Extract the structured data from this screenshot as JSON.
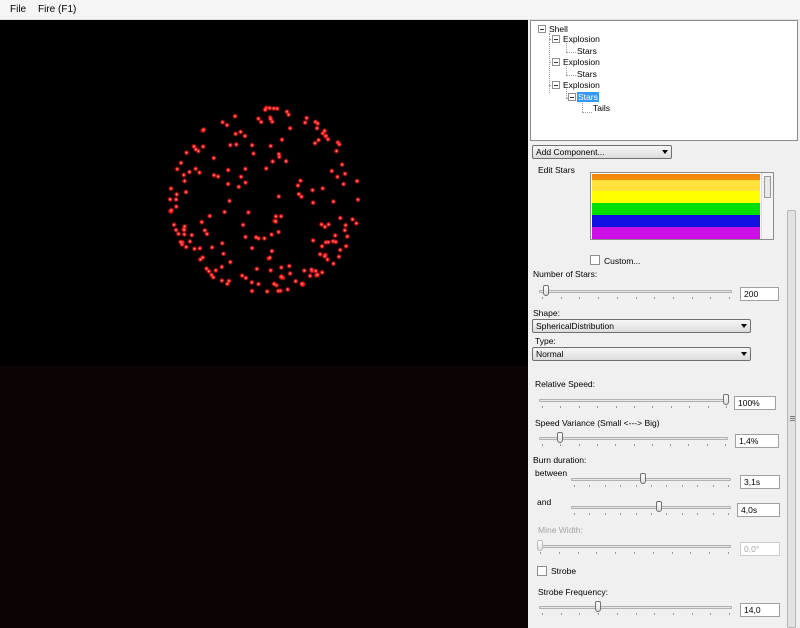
{
  "menu": {
    "file": "File",
    "fire": "Fire (F1)"
  },
  "tree": {
    "shell": "Shell",
    "explosion1": "Explosion",
    "stars1": "Stars",
    "explosion2": "Explosion",
    "stars2": "Stars",
    "explosion3": "Explosion",
    "stars3": "Stars",
    "tails": "Tails"
  },
  "add_component": {
    "label": "Add Component..."
  },
  "edit": {
    "title": "Edit Stars",
    "colors": [
      "#f58a0d",
      "#ffe13a",
      "#ffff00",
      "#00e000",
      "#1010e0",
      "#cc10e6"
    ],
    "custom_label": "Custom...",
    "number_of_stars": {
      "label": "Number of Stars:",
      "value": "200",
      "level": 0.02
    },
    "shape": {
      "label": "Shape:",
      "value": "SphericalDistribution"
    },
    "type": {
      "label": "Type:",
      "value": "Normal"
    },
    "relative_speed": {
      "label": "Relative Speed:",
      "value": "100%",
      "level": 1.0
    },
    "speed_variance": {
      "label": "Speed Variance (Small <---> Big)",
      "value": "1,4%",
      "level": 0.1
    },
    "burn_duration": {
      "label": "Burn duration:",
      "between_label": "between",
      "between_value": "3,1s",
      "between_level": 0.45,
      "and_label": "and",
      "and_value": "4,0s",
      "and_level": 0.55
    },
    "mine_width": {
      "label": "Mine Width:",
      "value": "0,0°",
      "level": 0.0
    },
    "strobe_label": "Strobe",
    "strobe_frequency": {
      "label": "Strobe Frequency:",
      "value": "14,0",
      "level": 0.3
    }
  },
  "colors": {
    "accent": "#3399ff",
    "star": "#ff2a2a",
    "sky": "#000000",
    "ground": "#0b0302"
  }
}
